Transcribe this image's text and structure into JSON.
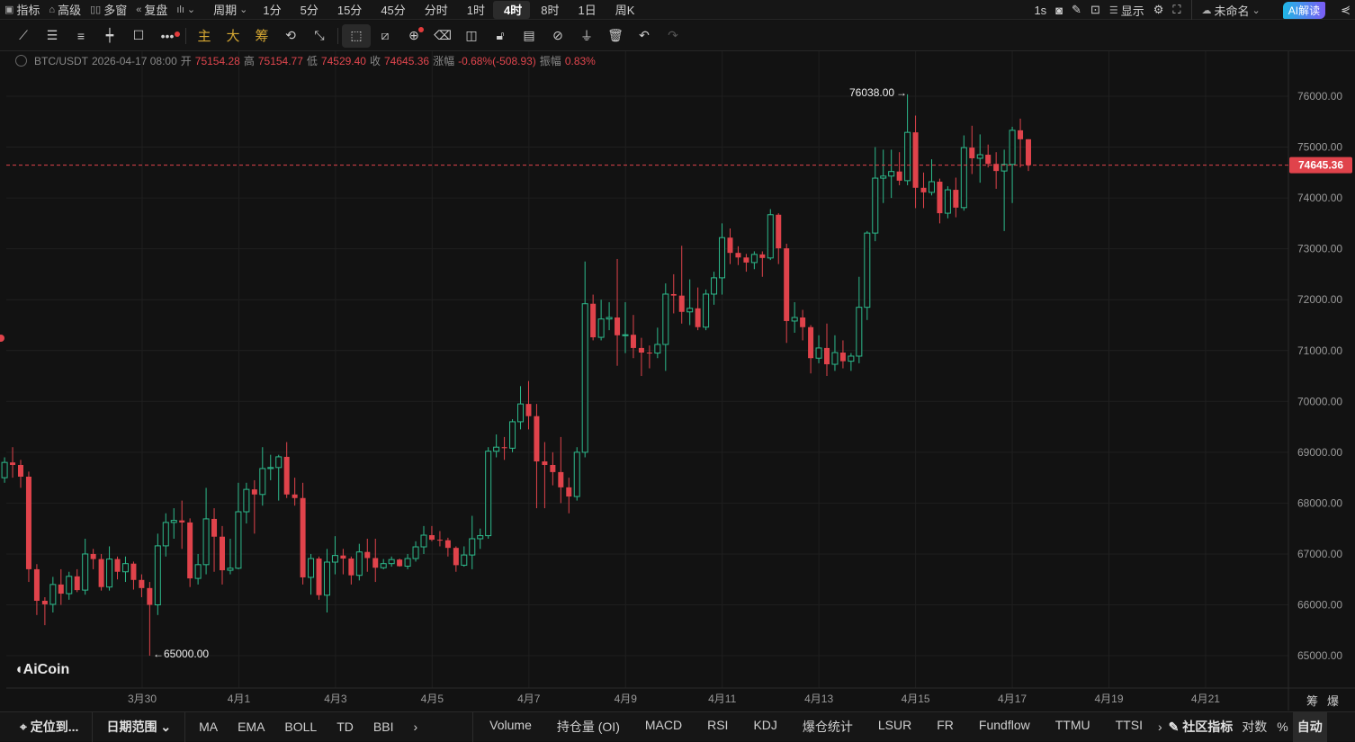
{
  "topbar": {
    "left": [
      {
        "icon": "indicator-icon",
        "label": "指标"
      },
      {
        "icon": "advanced-icon",
        "label": "高级"
      },
      {
        "icon": "multi-window-icon",
        "label": "多窗"
      },
      {
        "icon": "replay-icon",
        "label": "复盘"
      }
    ],
    "chart_type_icon": "candle-type-icon",
    "period_label": "周期",
    "periods": [
      "1分",
      "5分",
      "15分",
      "45分",
      "分时",
      "1时",
      "4时",
      "8时",
      "1日",
      "周K"
    ],
    "selected_period": "4时",
    "refresh": "1s",
    "display_label": "显示",
    "layout_name": "未命名",
    "ai_label": "AI解读"
  },
  "drawbar": {
    "gold": [
      "主",
      "大",
      "筹"
    ]
  },
  "info": {
    "symbol": "BTC/USDT",
    "datetime": "2026-04-17 08:00",
    "open_label": "开",
    "open": "75154.28",
    "high_label": "高",
    "high": "75154.77",
    "low_label": "低",
    "low": "74529.40",
    "close_label": "收",
    "close": "74645.36",
    "change_label": "涨幅",
    "change": "-0.68%(-508.93)",
    "amp_label": "振幅",
    "amp": "0.83%"
  },
  "colors": {
    "up": "#2dba8c",
    "down": "#e0434b",
    "bg": "#121212"
  },
  "chart_data": {
    "type": "candlestick",
    "y_ticks": [
      "76000.00",
      "75000.00",
      "74000.00",
      "73000.00",
      "72000.00",
      "71000.00",
      "70000.00",
      "69000.00",
      "68000.00",
      "67000.00",
      "66000.00",
      "65000.00"
    ],
    "ylim": [
      64600,
      76900
    ],
    "x_ticks": [
      "3月30",
      "4月1",
      "4月3",
      "4月5",
      "4月7",
      "4月9",
      "4月11",
      "4月13",
      "4月15",
      "4月17",
      "4月19",
      "4月21"
    ],
    "last_price": "74645.36",
    "max_label": "76038.00",
    "min_label": "65000.00",
    "ohlc": [
      [
        68500,
        68900,
        68400,
        68800
      ],
      [
        68800,
        69100,
        68500,
        68750
      ],
      [
        68750,
        68850,
        68300,
        68520
      ],
      [
        68520,
        68620,
        66450,
        66700
      ],
      [
        66700,
        66800,
        65800,
        66080
      ],
      [
        66080,
        66150,
        65600,
        66010
      ],
      [
        66010,
        66550,
        65850,
        66400
      ],
      [
        66400,
        66700,
        66000,
        66220
      ],
      [
        66220,
        66650,
        66100,
        66560
      ],
      [
        66560,
        66700,
        66250,
        66290
      ],
      [
        66290,
        67300,
        66200,
        67000
      ],
      [
        67000,
        67100,
        66700,
        66900
      ],
      [
        66900,
        67000,
        66280,
        66350
      ],
      [
        66350,
        67150,
        66280,
        66900
      ],
      [
        66900,
        66950,
        66500,
        66650
      ],
      [
        66650,
        66950,
        66450,
        66810
      ],
      [
        66810,
        66850,
        66300,
        66490
      ],
      [
        66490,
        66600,
        66150,
        66330
      ],
      [
        66330,
        66450,
        65000,
        66000
      ],
      [
        66000,
        67400,
        65800,
        67160
      ],
      [
        67160,
        67800,
        66950,
        67620
      ],
      [
        67620,
        67900,
        67300,
        67660
      ],
      [
        67660,
        68050,
        67100,
        67620
      ],
      [
        67620,
        67700,
        66350,
        66520
      ],
      [
        66520,
        67000,
        66400,
        66790
      ],
      [
        66790,
        68300,
        66600,
        67690
      ],
      [
        67690,
        67900,
        66650,
        67340
      ],
      [
        67340,
        67550,
        66400,
        66680
      ],
      [
        66680,
        67300,
        66600,
        66720
      ],
      [
        66720,
        68400,
        66700,
        67830
      ],
      [
        67830,
        68400,
        67600,
        68270
      ],
      [
        68270,
        68450,
        67400,
        68170
      ],
      [
        68170,
        69100,
        67950,
        68680
      ],
      [
        68680,
        68950,
        68450,
        68700
      ],
      [
        68700,
        68950,
        68050,
        68910
      ],
      [
        68910,
        69200,
        68100,
        68170
      ],
      [
        68170,
        68500,
        67950,
        68100
      ],
      [
        68100,
        68400,
        66400,
        66540
      ],
      [
        66540,
        67000,
        66200,
        66910
      ],
      [
        66910,
        66950,
        66100,
        66190
      ],
      [
        66190,
        67100,
        65850,
        66840
      ],
      [
        66840,
        67350,
        66600,
        66970
      ],
      [
        66970,
        67100,
        66600,
        66910
      ],
      [
        66910,
        66950,
        66400,
        66580
      ],
      [
        66580,
        67200,
        66480,
        67040
      ],
      [
        67040,
        67300,
        66650,
        66920
      ],
      [
        66920,
        67300,
        66450,
        66730
      ],
      [
        66730,
        66900,
        66700,
        66810
      ],
      [
        66810,
        66950,
        66750,
        66890
      ],
      [
        66890,
        66910,
        66750,
        66760
      ],
      [
        66760,
        67000,
        66700,
        66910
      ],
      [
        66910,
        67250,
        66850,
        67140
      ],
      [
        67140,
        67550,
        67000,
        67370
      ],
      [
        67370,
        67550,
        67250,
        67280
      ],
      [
        67280,
        67450,
        67150,
        67270
      ],
      [
        67270,
        67320,
        66950,
        67120
      ],
      [
        67120,
        67150,
        66650,
        66780
      ],
      [
        66780,
        67150,
        66750,
        66980
      ],
      [
        66980,
        67750,
        66700,
        67300
      ],
      [
        67300,
        67500,
        67100,
        67360
      ],
      [
        67360,
        69100,
        67300,
        69020
      ],
      [
        69020,
        69350,
        68900,
        69100
      ],
      [
        69100,
        69300,
        68850,
        69080
      ],
      [
        69080,
        69650,
        69000,
        69600
      ],
      [
        69600,
        70300,
        69450,
        69950
      ],
      [
        69950,
        70400,
        69450,
        69710
      ],
      [
        69710,
        69950,
        67900,
        68820
      ],
      [
        68820,
        69200,
        67900,
        68750
      ],
      [
        68750,
        69000,
        68350,
        68610
      ],
      [
        68610,
        69300,
        68000,
        68310
      ],
      [
        68310,
        68500,
        67800,
        68130
      ],
      [
        68130,
        69100,
        68050,
        69000
      ],
      [
        69000,
        72750,
        68900,
        71920
      ],
      [
        71920,
        72100,
        71200,
        71260
      ],
      [
        71260,
        72000,
        71200,
        71620
      ],
      [
        71620,
        71950,
        71400,
        71650
      ],
      [
        71650,
        72800,
        70700,
        71300
      ],
      [
        71300,
        71950,
        70950,
        71310
      ],
      [
        71310,
        71700,
        70850,
        71050
      ],
      [
        71050,
        71250,
        70500,
        70960
      ],
      [
        70960,
        71100,
        70650,
        70950
      ],
      [
        70950,
        71450,
        70850,
        71120
      ],
      [
        71120,
        72320,
        70600,
        72110
      ],
      [
        72110,
        72500,
        71730,
        72080
      ],
      [
        72080,
        73060,
        71530,
        71760
      ],
      [
        71760,
        72400,
        71500,
        71830
      ],
      [
        71830,
        72240,
        71400,
        71460
      ],
      [
        71460,
        72200,
        71400,
        72110
      ],
      [
        72110,
        72550,
        71900,
        72430
      ],
      [
        72430,
        73500,
        72100,
        73220
      ],
      [
        73220,
        73400,
        72700,
        72920
      ],
      [
        72920,
        73050,
        72680,
        72830
      ],
      [
        72830,
        72900,
        72550,
        72730
      ],
      [
        72730,
        72950,
        72600,
        72890
      ],
      [
        72890,
        72950,
        72450,
        72820
      ],
      [
        72820,
        73780,
        72780,
        73670
      ],
      [
        73670,
        73700,
        72700,
        73010
      ],
      [
        73010,
        73100,
        71150,
        71580
      ],
      [
        71580,
        71950,
        71350,
        71650
      ],
      [
        71650,
        71800,
        71200,
        71460
      ],
      [
        71460,
        71500,
        70550,
        70850
      ],
      [
        70850,
        71300,
        70750,
        71050
      ],
      [
        71050,
        71530,
        70500,
        70730
      ],
      [
        70730,
        71300,
        70600,
        70960
      ],
      [
        70960,
        71200,
        70650,
        70790
      ],
      [
        70790,
        70950,
        70600,
        70890
      ],
      [
        70890,
        72450,
        70750,
        71850
      ],
      [
        71850,
        73350,
        71600,
        73310
      ],
      [
        73310,
        75000,
        73150,
        74390
      ],
      [
        74390,
        74950,
        73900,
        74430
      ],
      [
        74430,
        74950,
        74000,
        74520
      ],
      [
        74520,
        74900,
        74250,
        74340
      ],
      [
        74340,
        76038,
        74250,
        75290
      ],
      [
        75290,
        75620,
        73800,
        74200
      ],
      [
        74200,
        74500,
        73800,
        74110
      ],
      [
        74110,
        74760,
        74050,
        74320
      ],
      [
        74320,
        74380,
        73500,
        73700
      ],
      [
        73700,
        74230,
        73600,
        74160
      ],
      [
        74160,
        74400,
        73620,
        73810
      ],
      [
        73810,
        75230,
        73750,
        74990
      ],
      [
        74990,
        75420,
        74470,
        74780
      ],
      [
        74780,
        75250,
        74300,
        74850
      ],
      [
        74850,
        75050,
        74600,
        74670
      ],
      [
        74670,
        74900,
        74180,
        74530
      ],
      [
        74530,
        74950,
        73350,
        74660
      ],
      [
        74660,
        75400,
        73900,
        75330
      ],
      [
        75330,
        75560,
        74600,
        75154.28
      ],
      [
        75154.28,
        75154.77,
        74529.4,
        74645.36
      ]
    ]
  },
  "watermark": "AiCoin",
  "axis_corner": [
    "筹",
    "爆"
  ],
  "bottombar": {
    "locate": "定位到...",
    "date_range": "日期范围",
    "main_indicators": [
      "MA",
      "EMA",
      "BOLL",
      "TD",
      "BBI"
    ],
    "sub_indicators": [
      "Volume",
      "持仓量 (OI)",
      "MACD",
      "RSI",
      "KDJ",
      "爆仓统计",
      "LSUR",
      "FR",
      "Fundflow",
      "TTMU",
      "TTSI"
    ],
    "community": "社区指标",
    "log": "对数",
    "percent": "%",
    "auto": "自动"
  }
}
